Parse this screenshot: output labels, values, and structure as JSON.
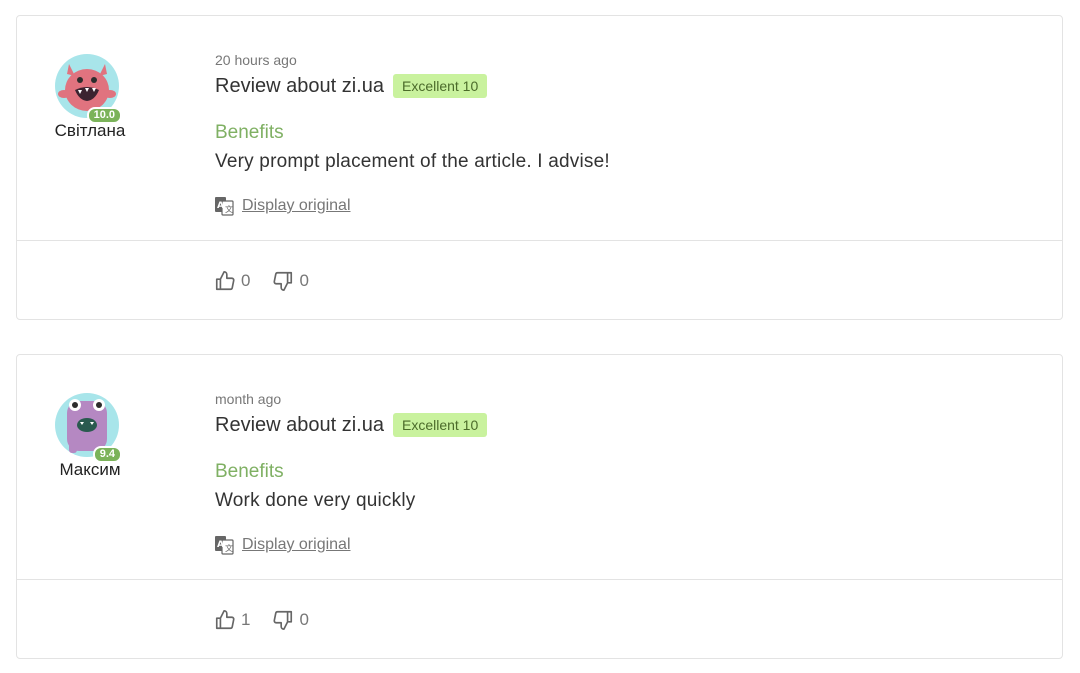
{
  "reviews": [
    {
      "time": "20 hours ago",
      "title": "Review about zi.ua",
      "rating_badge": "Excellent 10",
      "author": "Світлана",
      "author_score": "10.0",
      "section_label": "Benefits",
      "text": "Very prompt placement of the article. I advise!",
      "original_link": "Display original",
      "likes": "0",
      "dislikes": "0",
      "avatar_icon": "pink-monster-icon",
      "colors": {
        "avatar_bg": "#a8e5ea",
        "monster": "#e0737f"
      }
    },
    {
      "time": "month ago",
      "title": "Review about zi.ua",
      "rating_badge": "Excellent 10",
      "author": "Максим",
      "author_score": "9.4",
      "section_label": "Benefits",
      "text": "Work done very quickly",
      "original_link": "Display original",
      "likes": "1",
      "dislikes": "0",
      "avatar_icon": "purple-monster-icon",
      "colors": {
        "avatar_bg": "#a8e5ea",
        "monster": "#b588c2"
      }
    }
  ],
  "colors": {
    "accent_green": "#7fb063",
    "badge_bg": "#c9f29e",
    "score_badge": "#7bb35a",
    "border": "#e3e3e3"
  }
}
